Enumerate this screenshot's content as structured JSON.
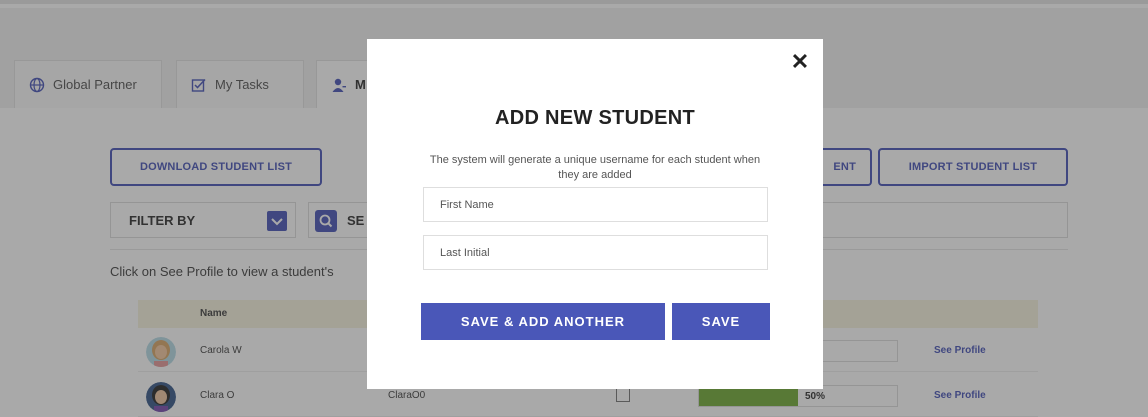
{
  "tabs": [
    {
      "label": "Global Partner",
      "icon": "globe-icon"
    },
    {
      "label": "My Tasks",
      "icon": "edit-checkbox-icon"
    },
    {
      "label": "M",
      "icon": "user-icon"
    }
  ],
  "toolbar": {
    "download_label": "DOWNLOAD STUDENT LIST",
    "add_student_partial": "ENT",
    "import_label": "IMPORT STUDENT LIST"
  },
  "filter": {
    "label": "FILTER BY"
  },
  "search": {
    "label": "SE"
  },
  "info_text": "Click on See Profile to view a student's",
  "table": {
    "header_name": "Name",
    "rows": [
      {
        "name": "Carola W",
        "username": "",
        "progress_text": "%",
        "progress": 0.0,
        "link": "See Profile"
      },
      {
        "name": "Clara O",
        "username": "ClaraO0",
        "progress_text": "50%",
        "progress": 0.5,
        "link": "See Profile"
      }
    ]
  },
  "modal": {
    "close_glyph": "✕",
    "title": "ADD NEW STUDENT",
    "description": "The system will generate a unique username for each student when they are added",
    "first_name_placeholder": "First Name",
    "last_initial_placeholder": "Last Initial",
    "save_add_another_label": "SAVE & ADD ANOTHER",
    "save_label": "SAVE"
  },
  "colors": {
    "accent": "#4a57b8",
    "progress": "#74ad3a",
    "overlay": "rgba(50,50,50,0.42)"
  }
}
